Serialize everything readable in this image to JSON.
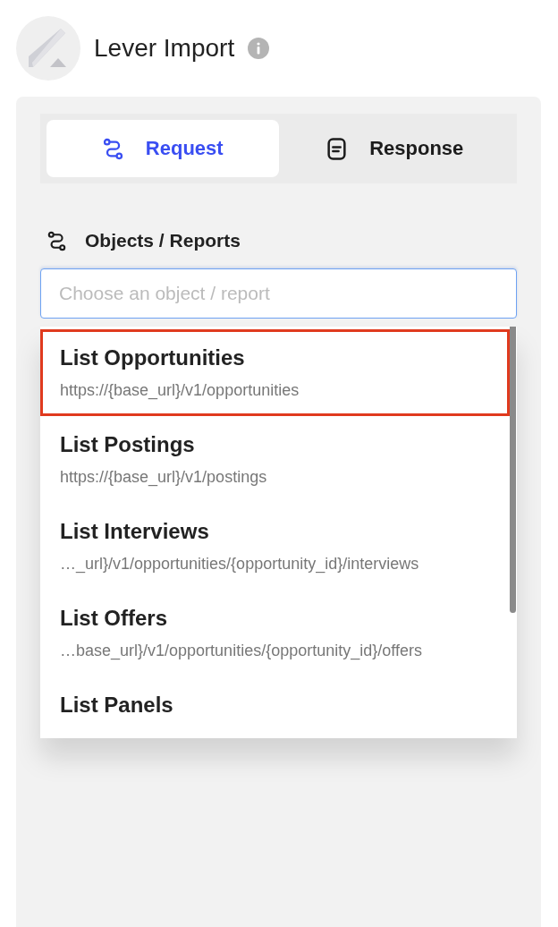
{
  "header": {
    "title": "Lever Import"
  },
  "tabs": [
    {
      "label": "Request",
      "selected": true
    },
    {
      "label": "Response",
      "selected": false
    }
  ],
  "field": {
    "label": "Objects / Reports",
    "placeholder": "Choose an object / report"
  },
  "options": [
    {
      "title": "List Opportunities",
      "url": "https://{base_url}/v1/opportunities",
      "selected": true
    },
    {
      "title": "List Postings",
      "url": "https://{base_url}/v1/postings",
      "selected": false
    },
    {
      "title": "List Interviews",
      "url": "…_url}/v1/opportunities/{opportunity_id}/interviews",
      "selected": false
    },
    {
      "title": "List Offers",
      "url": "…base_url}/v1/opportunities/{opportunity_id}/offers",
      "selected": false
    },
    {
      "title": "List Panels",
      "selected": false
    }
  ]
}
